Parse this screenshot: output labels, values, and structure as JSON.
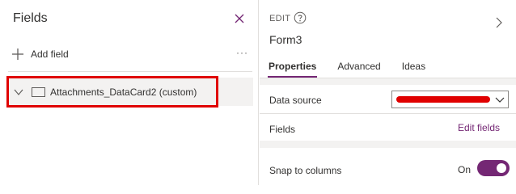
{
  "fields_pane": {
    "title": "Fields",
    "add_field_label": "Add field",
    "more_label": "···",
    "cards": [
      {
        "label": "Attachments_DataCard2 (custom)"
      }
    ]
  },
  "properties_pane": {
    "section_label": "EDIT",
    "form_name": "Form3",
    "tabs": [
      {
        "label": "Properties",
        "active": true
      },
      {
        "label": "Advanced",
        "active": false
      },
      {
        "label": "Ideas",
        "active": false
      }
    ],
    "data_source_label": "Data source",
    "fields_label": "Fields",
    "edit_fields_link": "Edit fields",
    "snap_label": "Snap to columns",
    "snap_state_label": "On",
    "snap_on": true
  },
  "colors": {
    "accent": "#742774",
    "highlight": "#e00000",
    "row_hover": "#f3f2f1",
    "divider": "#e1dfdd"
  },
  "icons": {
    "close": "close-icon",
    "add": "plus-icon",
    "expand_card": "chevron-down-icon",
    "card_type": "rectangle-icon",
    "help": "help-circle-icon",
    "expand_pane": "chevron-right-icon",
    "dropdown": "chevron-down-icon"
  }
}
